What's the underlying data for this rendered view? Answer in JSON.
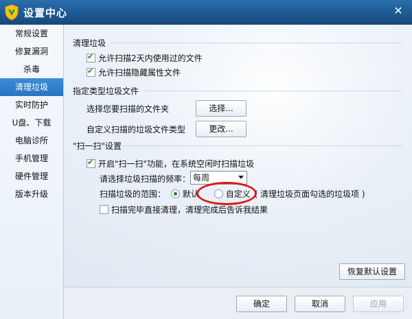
{
  "window": {
    "title": "设置中心",
    "close_label": "✕"
  },
  "sidebar": {
    "items": [
      {
        "label": "常规设置"
      },
      {
        "label": "修复漏洞"
      },
      {
        "label": "杀毒"
      },
      {
        "label": "清理垃圾",
        "active": true
      },
      {
        "label": "实时防护"
      },
      {
        "label": "U盘、下载"
      },
      {
        "label": "电脑诊所"
      },
      {
        "label": "手机管理"
      },
      {
        "label": "硬件管理"
      },
      {
        "label": "版本升级"
      }
    ]
  },
  "clean": {
    "title": "清理垃圾",
    "opt1": {
      "label": "允许扫描2天内使用过的文件",
      "checked": true
    },
    "opt2": {
      "label": "允许扫描隐藏属性文件",
      "checked": true
    }
  },
  "filetype": {
    "title": "指定类型垃圾文件",
    "folder_label": "选择您要扫描的文件夹",
    "folder_button": "选择...",
    "type_label": "自定义扫描的垃圾文件类型",
    "type_button": "更改..."
  },
  "scan": {
    "title": "\"扫一扫\"设置",
    "enable": {
      "label": "开启\"扫一扫\"功能，在系统空闲时扫描垃圾",
      "checked": true
    },
    "freq_label": "请选择垃圾扫描的频率：",
    "freq_value": "每周",
    "range_label": "扫描垃圾的范围：",
    "range_default": "默认",
    "range_custom": "自定义",
    "range_note": "( 清理垃圾页面勾选的垃圾项 )",
    "direct": {
      "label": "扫描完毕直接清理，清理完成后告诉我结果",
      "checked": false
    }
  },
  "buttons": {
    "restore": "恢复默认设置",
    "ok": "确定",
    "cancel": "取消",
    "apply": "应用"
  },
  "colors": {
    "accent": "#2a74c0",
    "annotation": "#e01818",
    "check": "#1a8a1a"
  }
}
